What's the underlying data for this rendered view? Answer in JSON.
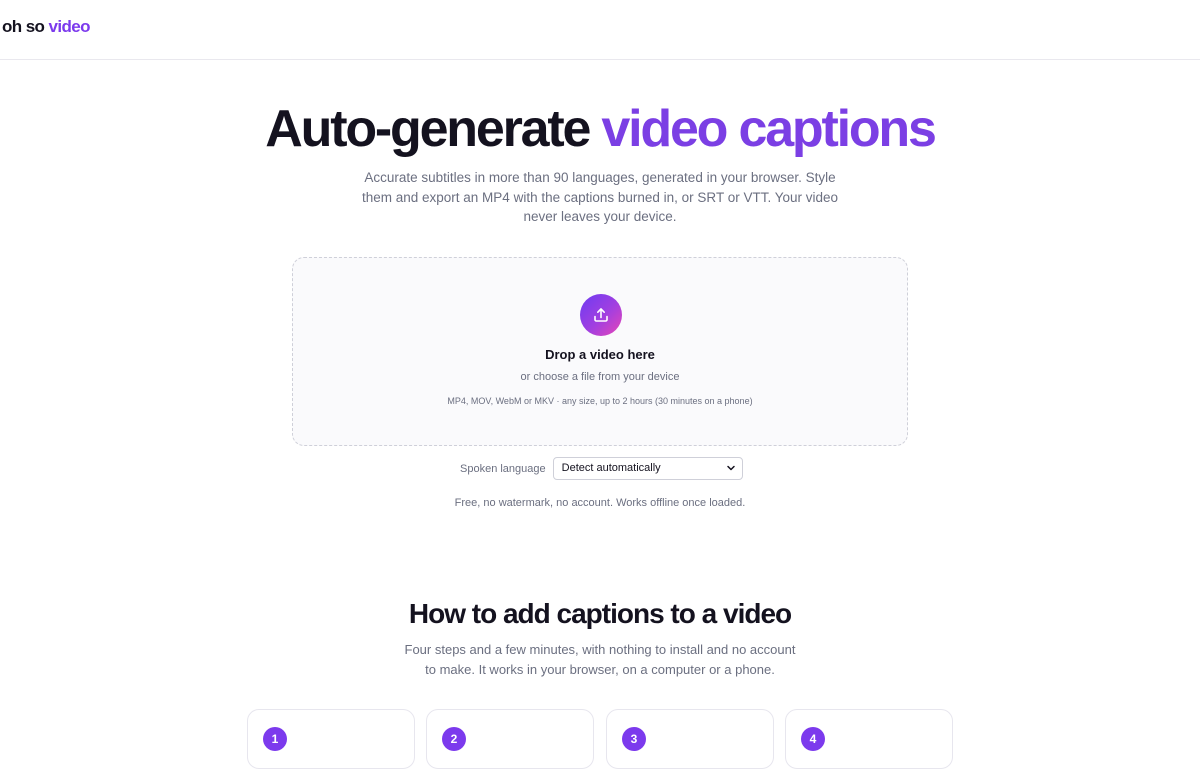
{
  "header": {
    "logo_part1": "oh so",
    "logo_part2": "video"
  },
  "hero": {
    "title_part1": "Auto-generate",
    "title_accent": "video captions",
    "subtitle": "Accurate subtitles in more than 90 languages, generated in your browser. Style them and export an MP4 with the captions burned in, or SRT or VTT. Your video never leaves your device."
  },
  "dropzone": {
    "icon": "upload-icon",
    "title": "Drop a video here",
    "subtitle": "or choose a file from your device",
    "formats": "MP4, MOV, WebM or MKV · any size, up to 2 hours (30 minutes on a phone)"
  },
  "language": {
    "label": "Spoken language",
    "selected": "Detect automatically"
  },
  "free_note": "Free, no watermark, no account. Works offline once loaded.",
  "how_to": {
    "title": "How to add captions to a video",
    "subtitle": "Four steps and a few minutes, with nothing to install and no account to make. It works in your browser, on a computer or a phone.",
    "steps": [
      {
        "number": "1"
      },
      {
        "number": "2"
      },
      {
        "number": "3"
      },
      {
        "number": "4"
      }
    ]
  },
  "colors": {
    "accent": "#7c3aed",
    "text": "#14121f",
    "muted": "#6b6f80"
  }
}
